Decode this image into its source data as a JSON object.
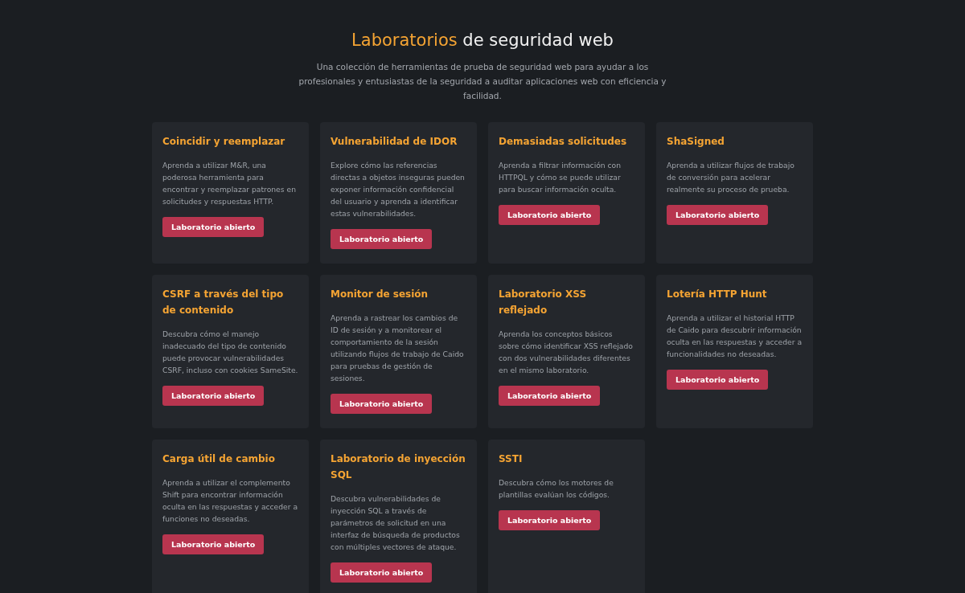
{
  "header": {
    "title_highlight": "Laboratorios",
    "title_rest": "de seguridad web",
    "subtitle": "Una colección de herramientas de prueba de seguridad web para ayudar a los profesionales y entusiastas de la seguridad a auditar aplicaciones web con eficiencia y facilidad."
  },
  "labs": [
    {
      "title": "Coincidir y reemplazar",
      "description": "Aprenda a utilizar M&R, una poderosa herramienta para encontrar y reemplazar patrones en solicitudes y respuestas HTTP.",
      "button": "Laboratorio abierto"
    },
    {
      "title": "Vulnerabilidad de IDOR",
      "description": "Explore cómo las referencias directas a objetos inseguras pueden exponer información confidencial del usuario y aprenda a identificar estas vulnerabilidades.",
      "button": "Laboratorio abierto"
    },
    {
      "title": "Demasiadas solicitudes",
      "description": "Aprenda a filtrar información con HTTPQL y cómo se puede utilizar para buscar información oculta.",
      "button": "Laboratorio abierto"
    },
    {
      "title": "ShaSigned",
      "description": "Aprenda a utilizar flujos de trabajo de conversión para acelerar realmente su proceso de prueba.",
      "button": "Laboratorio abierto"
    },
    {
      "title": "CSRF a través del tipo de contenido",
      "description": "Descubra cómo el manejo inadecuado del tipo de contenido puede provocar vulnerabilidades CSRF, incluso con cookies SameSite.",
      "button": "Laboratorio abierto"
    },
    {
      "title": "Monitor de sesión",
      "description": "Aprenda a rastrear los cambios de ID de sesión y a monitorear el comportamiento de la sesión utilizando flujos de trabajo de Caido para pruebas de gestión de sesiones.",
      "button": "Laboratorio abierto"
    },
    {
      "title": "Laboratorio XSS reflejado",
      "description": "Aprenda los conceptos básicos sobre cómo identificar XSS reflejado con dos vulnerabilidades diferentes en el mismo laboratorio.",
      "button": "Laboratorio abierto"
    },
    {
      "title": "Lotería HTTP Hunt",
      "description": "Aprenda a utilizar el historial HTTP de Caido para descubrir información oculta en las respuestas y acceder a funcionalidades no deseadas.",
      "button": "Laboratorio abierto"
    },
    {
      "title": "Carga útil de cambio",
      "description": "Aprenda a utilizar el complemento Shift para encontrar información oculta en las respuestas y acceder a funciones no deseadas.",
      "button": "Laboratorio abierto"
    },
    {
      "title": "Laboratorio de inyección SQL",
      "description": "Descubra vulnerabilidades de inyección SQL a través de parámetros de solicitud en una interfaz de búsqueda de productos con múltiples vectores de ataque.",
      "button": "Laboratorio abierto"
    },
    {
      "title": "SSTI",
      "description": "Descubra cómo los motores de plantillas evalúan los códigos.",
      "button": "Laboratorio abierto"
    }
  ]
}
